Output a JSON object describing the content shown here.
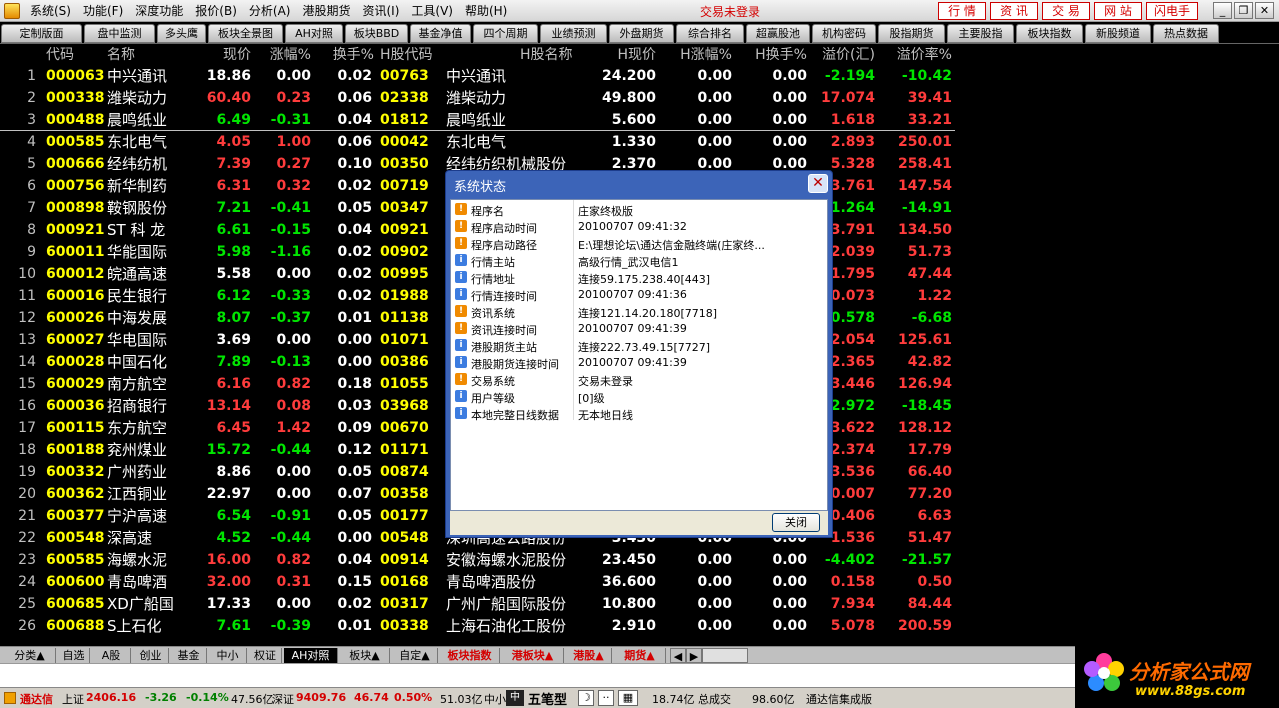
{
  "menu": [
    "系统(S)",
    "功能(F)",
    "深度功能",
    "报价(B)",
    "分析(A)",
    "港股期货",
    "资讯(I)",
    "工具(V)",
    "帮助(H)"
  ],
  "trade_status": "交易未登录",
  "top_buttons": [
    "行 情",
    "资 讯",
    "交 易",
    "网 站",
    "闪电手"
  ],
  "window_buttons": [
    "_",
    "❐",
    "✕"
  ],
  "tabs": [
    "定制版面",
    "盘中监测",
    "多头鹰",
    "板块全景图",
    "AH对照",
    "板块BBD",
    "基金净值",
    "四个周期",
    "业绩预测",
    "外盘期货",
    "综合排名",
    "超赢股池",
    "机构密码",
    "股指期货",
    "主要股指",
    "板块指数",
    "新股频道",
    "热点数据"
  ],
  "columns": [
    "代码",
    "名称",
    "现价",
    "涨幅%",
    "换手%",
    "H股代码",
    "H股名称",
    "H现价",
    "H涨幅%",
    "H换手%",
    "溢价(汇)",
    "溢价率%"
  ],
  "rows": [
    {
      "no": "1",
      "code": "000063",
      "name": "中兴通讯",
      "price": "18.86",
      "chg": "0.00",
      "turn": "0.02",
      "hcode": "00763",
      "hname": "中兴通讯",
      "hprice": "24.200",
      "hchg": "0.00",
      "hturn": "0.00",
      "prem": "-2.194",
      "rate": "-10.42"
    },
    {
      "no": "2",
      "code": "000338",
      "name": "潍柴动力",
      "price": "60.40",
      "chg": "0.23",
      "turn": "0.06",
      "hcode": "02338",
      "hname": "潍柴动力",
      "hprice": "49.800",
      "hchg": "0.00",
      "hturn": "0.00",
      "prem": "17.074",
      "rate": "39.41"
    },
    {
      "no": "3",
      "code": "000488",
      "name": "晨鸣纸业",
      "price": "6.49",
      "chg": "-0.31",
      "turn": "0.04",
      "hcode": "01812",
      "hname": "晨鸣纸业",
      "hprice": "5.600",
      "hchg": "0.00",
      "hturn": "0.00",
      "prem": "1.618",
      "rate": "33.21"
    },
    {
      "no": "4",
      "code": "000585",
      "name": "东北电气",
      "price": "4.05",
      "chg": "1.00",
      "turn": "0.06",
      "hcode": "00042",
      "hname": "东北电气",
      "hprice": "1.330",
      "hchg": "0.00",
      "hturn": "0.00",
      "prem": "2.893",
      "rate": "250.01"
    },
    {
      "no": "5",
      "code": "000666",
      "name": "经纬纺机",
      "price": "7.39",
      "chg": "0.27",
      "turn": "0.10",
      "hcode": "00350",
      "hname": "经纬纺织机械股份",
      "hprice": "2.370",
      "hchg": "0.00",
      "hturn": "0.00",
      "prem": "5.328",
      "rate": "258.41"
    },
    {
      "no": "6",
      "code": "000756",
      "name": "新华制药",
      "price": "6.31",
      "chg": "0.32",
      "turn": "0.02",
      "hcode": "00719",
      "hname": "",
      "hprice": "",
      "hchg": "",
      "hturn": "",
      "prem": "3.761",
      "rate": "147.54"
    },
    {
      "no": "7",
      "code": "000898",
      "name": "鞍钢股份",
      "price": "7.21",
      "chg": "-0.41",
      "turn": "0.05",
      "hcode": "00347",
      "hname": "",
      "hprice": "",
      "hchg": "",
      "hturn": "",
      "prem": "-1.264",
      "rate": "-14.91"
    },
    {
      "no": "8",
      "code": "000921",
      "name": "ST 科 龙",
      "price": "6.61",
      "chg": "-0.15",
      "turn": "0.04",
      "hcode": "00921",
      "hname": "",
      "hprice": "",
      "hchg": "",
      "hturn": "",
      "prem": "3.791",
      "rate": "134.50"
    },
    {
      "no": "9",
      "code": "600011",
      "name": "华能国际",
      "price": "5.98",
      "chg": "-1.16",
      "turn": "0.02",
      "hcode": "00902",
      "hname": "",
      "hprice": "",
      "hchg": "",
      "hturn": "",
      "prem": "2.039",
      "rate": "51.73"
    },
    {
      "no": "10",
      "code": "600012",
      "name": "皖通高速",
      "price": "5.58",
      "chg": "0.00",
      "turn": "0.02",
      "hcode": "00995",
      "hname": "",
      "hprice": "",
      "hchg": "",
      "hturn": "",
      "prem": "1.795",
      "rate": "47.44"
    },
    {
      "no": "11",
      "code": "600016",
      "name": "民生银行",
      "price": "6.12",
      "chg": "-0.33",
      "turn": "0.02",
      "hcode": "01988",
      "hname": "",
      "hprice": "",
      "hchg": "",
      "hturn": "",
      "prem": "0.073",
      "rate": "1.22"
    },
    {
      "no": "12",
      "code": "600026",
      "name": "中海发展",
      "price": "8.07",
      "chg": "-0.37",
      "turn": "0.01",
      "hcode": "01138",
      "hname": "",
      "hprice": "",
      "hchg": "",
      "hturn": "",
      "prem": "-0.578",
      "rate": "-6.68"
    },
    {
      "no": "13",
      "code": "600027",
      "name": "华电国际",
      "price": "3.69",
      "chg": "0.00",
      "turn": "0.00",
      "hcode": "01071",
      "hname": "",
      "hprice": "",
      "hchg": "",
      "hturn": "",
      "prem": "2.054",
      "rate": "125.61"
    },
    {
      "no": "14",
      "code": "600028",
      "name": "中国石化",
      "price": "7.89",
      "chg": "-0.13",
      "turn": "0.00",
      "hcode": "00386",
      "hname": "",
      "hprice": "",
      "hchg": "",
      "hturn": "",
      "prem": "2.365",
      "rate": "42.82"
    },
    {
      "no": "15",
      "code": "600029",
      "name": "南方航空",
      "price": "6.16",
      "chg": "0.82",
      "turn": "0.18",
      "hcode": "01055",
      "hname": "",
      "hprice": "",
      "hchg": "",
      "hturn": "",
      "prem": "3.446",
      "rate": "126.94"
    },
    {
      "no": "16",
      "code": "600036",
      "name": "招商银行",
      "price": "13.14",
      "chg": "0.08",
      "turn": "0.03",
      "hcode": "03968",
      "hname": "",
      "hprice": "",
      "hchg": "",
      "hturn": "",
      "prem": "-2.972",
      "rate": "-18.45"
    },
    {
      "no": "17",
      "code": "600115",
      "name": "东方航空",
      "price": "6.45",
      "chg": "1.42",
      "turn": "0.09",
      "hcode": "00670",
      "hname": "",
      "hprice": "",
      "hchg": "",
      "hturn": "",
      "prem": "3.622",
      "rate": "128.12"
    },
    {
      "no": "18",
      "code": "600188",
      "name": "兖州煤业",
      "price": "15.72",
      "chg": "-0.44",
      "turn": "0.12",
      "hcode": "01171",
      "hname": "",
      "hprice": "",
      "hchg": "",
      "hturn": "",
      "prem": "2.374",
      "rate": "17.79"
    },
    {
      "no": "19",
      "code": "600332",
      "name": "广州药业",
      "price": "8.86",
      "chg": "0.00",
      "turn": "0.05",
      "hcode": "00874",
      "hname": "",
      "hprice": "",
      "hchg": "",
      "hturn": "",
      "prem": "3.536",
      "rate": "66.40"
    },
    {
      "no": "20",
      "code": "600362",
      "name": "江西铜业",
      "price": "22.97",
      "chg": "0.00",
      "turn": "0.07",
      "hcode": "00358",
      "hname": "",
      "hprice": "",
      "hchg": "",
      "hturn": "",
      "prem": "10.007",
      "rate": "77.20"
    },
    {
      "no": "21",
      "code": "600377",
      "name": "宁沪高速",
      "price": "6.54",
      "chg": "-0.91",
      "turn": "0.05",
      "hcode": "00177",
      "hname": "",
      "hprice": "",
      "hchg": "",
      "hturn": "",
      "prem": "0.406",
      "rate": "6.63"
    },
    {
      "no": "22",
      "code": "600548",
      "name": "深高速",
      "price": "4.52",
      "chg": "-0.44",
      "turn": "0.00",
      "hcode": "00548",
      "hname": "深圳高速公路股份",
      "hprice": "3.430",
      "hchg": "0.00",
      "hturn": "0.00",
      "prem": "1.536",
      "rate": "51.47"
    },
    {
      "no": "23",
      "code": "600585",
      "name": "海螺水泥",
      "price": "16.00",
      "chg": "0.82",
      "turn": "0.04",
      "hcode": "00914",
      "hname": "安徽海螺水泥股份",
      "hprice": "23.450",
      "hchg": "0.00",
      "hturn": "0.00",
      "prem": "-4.402",
      "rate": "-21.57"
    },
    {
      "no": "24",
      "code": "600600",
      "name": "青岛啤酒",
      "price": "32.00",
      "chg": "0.31",
      "turn": "0.15",
      "hcode": "00168",
      "hname": "青岛啤酒股份",
      "hprice": "36.600",
      "hchg": "0.00",
      "hturn": "0.00",
      "prem": "0.158",
      "rate": "0.50"
    },
    {
      "no": "25",
      "code": "600685",
      "name": "XD广船国",
      "price": "17.33",
      "chg": "0.00",
      "turn": "0.02",
      "hcode": "00317",
      "hname": "广州广船国际股份",
      "hprice": "10.800",
      "hchg": "0.00",
      "hturn": "0.00",
      "prem": "7.934",
      "rate": "84.44"
    },
    {
      "no": "26",
      "code": "600688",
      "name": "S上石化",
      "price": "7.61",
      "chg": "-0.39",
      "turn": "0.01",
      "hcode": "00338",
      "hname": "上海石油化工股份",
      "hprice": "2.910",
      "hchg": "0.00",
      "hturn": "0.00",
      "prem": "5.078",
      "rate": "200.59"
    }
  ],
  "dialog": {
    "title": "系统状态",
    "close_label": "关闭",
    "items": [
      {
        "icon": "warning-icon",
        "label": "程序名",
        "value": "庄家终极版"
      },
      {
        "icon": "warning-icon",
        "label": "程序启动时间",
        "value": "20100707 09:41:32"
      },
      {
        "icon": "warning-icon",
        "label": "程序启动路径",
        "value": "E:\\理想论坛\\通达信金融终端(庄家终..."
      },
      {
        "icon": "info-icon",
        "label": "行情主站",
        "value": "高级行情_武汉电信1"
      },
      {
        "icon": "info-icon",
        "label": "行情地址",
        "value": "连接59.175.238.40[443]"
      },
      {
        "icon": "info-icon",
        "label": "行情连接时间",
        "value": "20100707 09:41:36"
      },
      {
        "icon": "warning-icon",
        "label": "资讯系统",
        "value": "连接121.14.20.180[7718]"
      },
      {
        "icon": "warning-icon",
        "label": "资讯连接时间",
        "value": "20100707 09:41:39"
      },
      {
        "icon": "info-icon",
        "label": "港股期货主站",
        "value": "连接222.73.49.15[7727]"
      },
      {
        "icon": "info-icon",
        "label": "港股期货连接时间",
        "value": "20100707 09:41:39"
      },
      {
        "icon": "warning-icon",
        "label": "交易系统",
        "value": "交易未登录"
      },
      {
        "icon": "info-icon",
        "label": "用户等级",
        "value": "[0]级"
      },
      {
        "icon": "info-icon",
        "label": "本地完整日线数据",
        "value": "无本地日线"
      }
    ]
  },
  "bottom_tabs": [
    "分类▲",
    "自选",
    "A股",
    "创业",
    "基金",
    "中小",
    "权证",
    "AH对照",
    "板块▲",
    "自定▲",
    "板块指数",
    "港板块▲",
    "港股▲",
    "期货▲"
  ],
  "status": {
    "app": "通达信",
    "sh_label": "上证",
    "sh_index": "2406.16",
    "sh_change": "-3.26",
    "sh_pct": "-0.14%",
    "sh_amount": "47.56亿",
    "sz_label": "深证",
    "sz_index": "9409.76",
    "sz_change": "46.74",
    "sz_pct": "0.50%",
    "sz_amount": "51.03亿",
    "zx_label": "中小",
    "input_method": "五笔型",
    "amount1": "18.74亿",
    "total_label": "总成交",
    "total_amount": "98.60亿",
    "edition": "通达信集成版"
  },
  "logo": {
    "text": "分析家公式网",
    "url": "www.88gs.com"
  },
  "colors": {
    "up": "#ff3c3c",
    "down": "#00e600",
    "neutral": "#ffffff",
    "code": "#ffff00",
    "name": "#ffffff",
    "red_tab": "#d40000"
  }
}
